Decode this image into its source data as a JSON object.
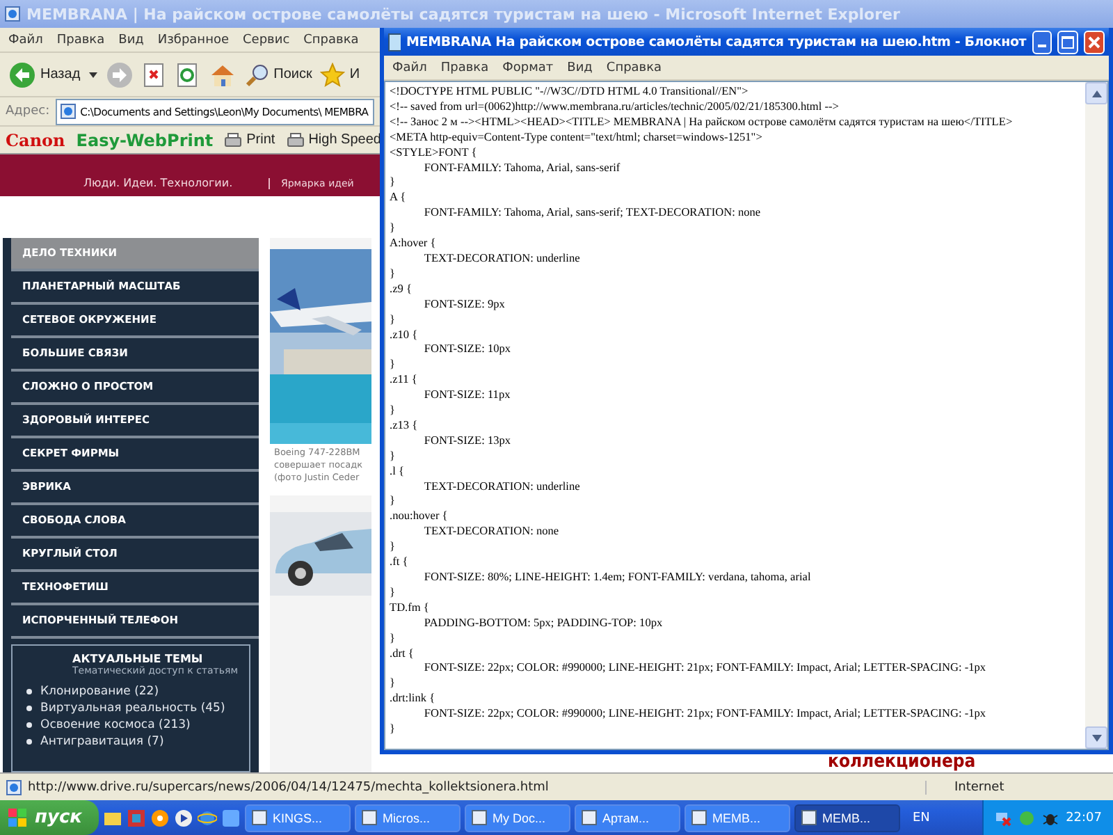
{
  "browser": {
    "title": "MEMBRANA | На райском острове самолёты садятся туристам на шею - Microsoft Internet Explorer",
    "menu": [
      "Файл",
      "Правка",
      "Вид",
      "Избранное",
      "Сервис",
      "Справка"
    ],
    "toolbar": {
      "back": "Назад",
      "search": "Поиск",
      "favorites": "И"
    },
    "address": {
      "label": "Адрес:",
      "value": "C:\\Documents and Settings\\Leon\\My Documents\\ MEMBRA"
    },
    "canon_bar": {
      "brand": "Canon",
      "product": "Easy-WebPrint",
      "print": "Print",
      "high_speed": "High Speed"
    },
    "status": {
      "url": "http://www.drive.ru/supercars/news/2006/04/14/12475/mechta_kollektsionera.html",
      "zone": "Internet"
    }
  },
  "site": {
    "tagline": "Люди. Идеи. Технологии.",
    "header_link": "Ярмарка идей",
    "nav": [
      {
        "label": "ДЕЛО ТЕХНИКИ",
        "selected": true
      },
      {
        "label": "ПЛАНЕТАРНЫЙ МАСШТАБ",
        "selected": false
      },
      {
        "label": "СЕТЕВОЕ ОКРУЖЕНИЕ",
        "selected": false
      },
      {
        "label": "БОЛЬШИЕ СВЯЗИ",
        "selected": false
      },
      {
        "label": "СЛОЖНО О ПРОСТОМ",
        "selected": false
      },
      {
        "label": "ЗДОРОВЫЙ ИНТЕРЕС",
        "selected": false
      },
      {
        "label": "СЕКРЕТ ФИРМЫ",
        "selected": false
      },
      {
        "label": "ЭВРИКА",
        "selected": false
      },
      {
        "label": "СВОБОДА СЛОВА",
        "selected": false
      },
      {
        "label": "КРУГЛЫЙ СТОЛ",
        "selected": false
      },
      {
        "label": "ТЕХНОФЕТИШ",
        "selected": false
      },
      {
        "label": "ИСПОРЧЕННЫЙ ТЕЛЕФОН",
        "selected": false
      }
    ],
    "topics": {
      "title": "АКТУАЛЬНЫЕ ТЕМЫ",
      "subtitle": "Тематический доступ к статьям",
      "items": [
        "Клонирование (22)",
        "Виртуальная реальность (45)",
        "Освоение космоса (213)",
        "Антигравитация (7)"
      ]
    },
    "photo_caption": [
      "Boeing 747-228BM",
      "совершает посадк",
      "(фото Justin Ceder"
    ],
    "bottom_heading": "коллекционера"
  },
  "notepad": {
    "title": "MEMBRANA  На райском острове самолёты садятся туристам на шею.htm - Блокнот",
    "menu": [
      "Файл",
      "Правка",
      "Формат",
      "Вид",
      "Справка"
    ],
    "lines": [
      "<!DOCTYPE HTML PUBLIC \"-//W3C//DTD HTML 4.0 Transitional//EN\">",
      "<!-- saved from url=(0062)http://www.membrana.ru/articles/technic/2005/02/21/185300.html -->",
      "<!-- Занос 2 м --><HTML><HEAD><TITLE> MEMBRANA | На райском острове самолётм садятся туристам на шею</TITLE>",
      "<META http-equiv=Content-Type content=\"text/html; charset=windows-1251\">",
      "<STYLE>FONT {",
      "\tFONT-FAMILY: Tahoma, Arial, sans-serif",
      "}",
      "A {",
      "\tFONT-FAMILY: Tahoma, Arial, sans-serif; TEXT-DECORATION: none",
      "}",
      "A:hover {",
      "\tTEXT-DECORATION: underline",
      "}",
      ".z9 {",
      "\tFONT-SIZE: 9px",
      "}",
      ".z10 {",
      "\tFONT-SIZE: 10px",
      "}",
      ".z11 {",
      "\tFONT-SIZE: 11px",
      "}",
      ".z13 {",
      "\tFONT-SIZE: 13px",
      "}",
      ".l {",
      "\tTEXT-DECORATION: underline",
      "}",
      ".nou:hover {",
      "\tTEXT-DECORATION: none",
      "}",
      ".ft {",
      "\tFONT-SIZE: 80%; LINE-HEIGHT: 1.4em; FONT-FAMILY: verdana, tahoma, arial",
      "}",
      "TD.fm {",
      "\tPADDING-BOTTOM: 5px; PADDING-TOP: 10px",
      "}",
      ".drt {",
      "\tFONT-SIZE: 22px; COLOR: #990000; LINE-HEIGHT: 21px; FONT-FAMILY: Impact, Arial; LETTER-SPACING: -1px",
      "}",
      ".drt:link {",
      "\tFONT-SIZE: 22px; COLOR: #990000; LINE-HEIGHT: 21px; FONT-FAMILY: Impact, Arial; LETTER-SPACING: -1px",
      "}"
    ]
  },
  "taskbar": {
    "start": "пуск",
    "tasks": [
      {
        "label": "KINGS...",
        "selected": false
      },
      {
        "label": "Micros...",
        "selected": false
      },
      {
        "label": "My Doc...",
        "selected": false
      },
      {
        "label": "Артам...",
        "selected": false
      },
      {
        "label": "MEMB...",
        "selected": false
      },
      {
        "label": "MEMB...",
        "selected": true
      }
    ],
    "language": "EN",
    "clock": "22:07"
  }
}
